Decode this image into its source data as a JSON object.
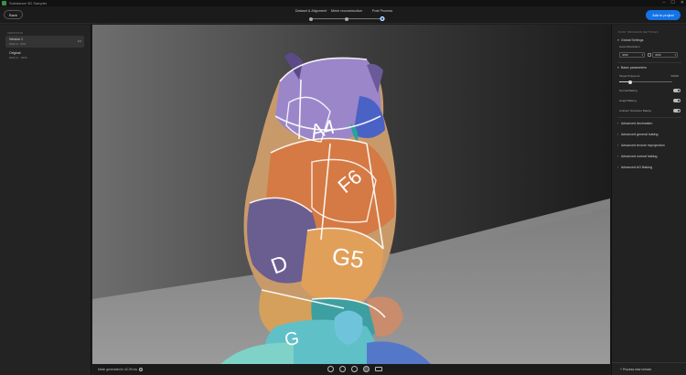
{
  "window": {
    "title": "Substance 3D Sampler",
    "controls": [
      "–",
      "☐",
      "✕"
    ]
  },
  "header": {
    "back_label": "Back",
    "steps": [
      {
        "label": "Dataset & Alignment",
        "state": "done"
      },
      {
        "label": "Mesh reconstruction",
        "state": "done"
      },
      {
        "label": "Post Process",
        "state": "active"
      }
    ],
    "add_label": "Add to project"
  },
  "left_panel": {
    "section_label": "VERSIONS",
    "versions": [
      {
        "name": "Version 1",
        "meta": "2023-11 · 80%",
        "selected": true
      },
      {
        "name": "Original",
        "meta": "2023-11 · 100%",
        "selected": false
      }
    ],
    "more_glyph": "•••"
  },
  "viewport": {
    "uv_labels": [
      "A4",
      "F6",
      "G5",
      "D",
      "G"
    ]
  },
  "bottom_bar": {
    "status": "Mesh generated in 42.09 ms",
    "info_glyph": "i"
  },
  "right_panel": {
    "title": "POST PROCESS SETTINGS",
    "global": {
      "title": "Global Settings",
      "resolution_label": "Asset Resolution",
      "res_x": "4096",
      "res_y": "4096"
    },
    "basic": {
      "title": "Basic parameters",
      "target_label": "Target Polycount",
      "target_value": "50000",
      "target_fraction": 0.2,
      "toggles": [
        {
          "label": "Normal Baking",
          "on": true
        },
        {
          "label": "Height Baking",
          "on": true
        },
        {
          "label": "Ambient Occlusion Baking",
          "on": true
        }
      ]
    },
    "collapsed_sections": [
      "Advanced decimation",
      "Advanced general baking",
      "Advanced texture reprojection",
      "Advanced normal baking",
      "Advanced AO Baking"
    ],
    "footer_label": "Process new version",
    "footer_glyph": "+"
  }
}
